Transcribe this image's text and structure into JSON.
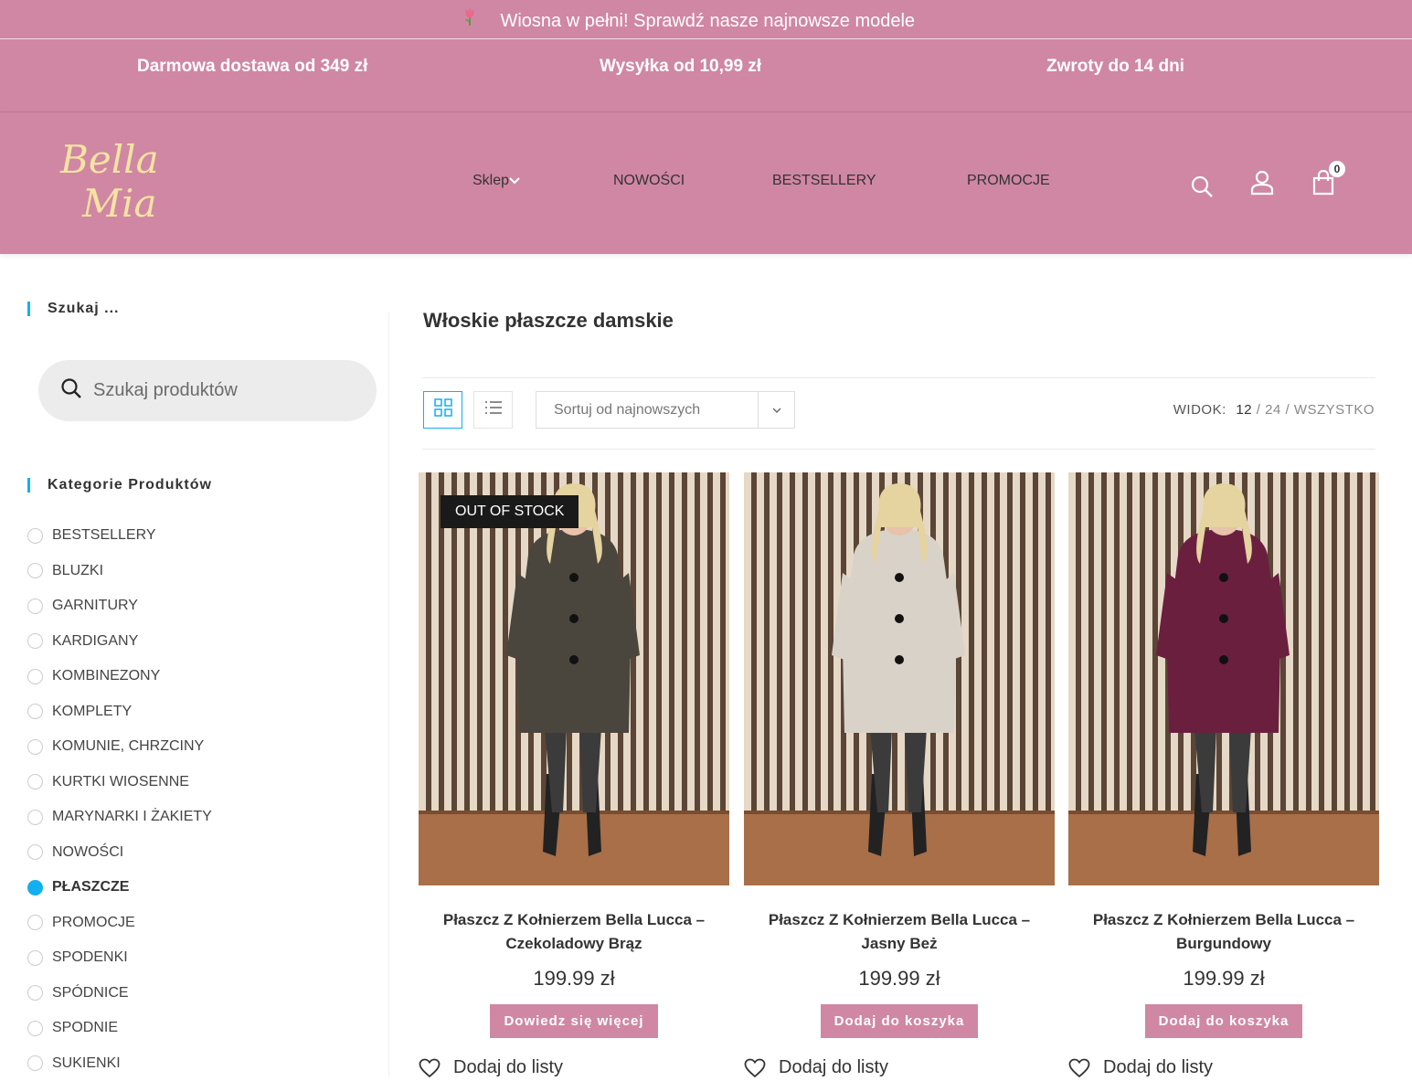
{
  "announcement": "Wiosna w pełni! Sprawdź nasze najnowsze modele",
  "benefits": [
    "Darmowa dostawa od 349 zł",
    "Wysyłka od 10,99 zł",
    "Zwroty do 14 dni"
  ],
  "logo_text": "Bella Mia",
  "nav": [
    {
      "label": "Sklep"
    },
    {
      "label": "NOWOŚCI"
    },
    {
      "label": "BESTSELLERY"
    },
    {
      "label": "PROMOCJE"
    }
  ],
  "cart_count": "0",
  "sidebar": {
    "search_title": "Szukaj ...",
    "search_placeholder": "Szukaj produktów",
    "categories_title": "Kategorie Produktów",
    "categories": [
      "BESTSELLERY",
      "BLUZKI",
      "GARNITURY",
      "KARDIGANY",
      "KOMBINEZONY",
      "KOMPLETY",
      "KOMUNIE, CHRZCINY",
      "KURTKI WIOSENNE",
      "MARYNARKI I ŻAKIETY",
      "NOWOŚCI",
      "PŁASZCZE",
      "PROMOCJE",
      "SPODENKI",
      "SPÓDNICE",
      "SPODNIE",
      "SUKIENKI"
    ],
    "active_category": "PŁASZCZE"
  },
  "main": {
    "title": "Włoskie płaszcze damskie",
    "sort_label": "Sortuj od najnowszych",
    "view_label": "WIDOK:",
    "view_options": [
      "12",
      "24",
      "WSZYSTKO"
    ],
    "view_sep": "/"
  },
  "products": [
    {
      "title": "Płaszcz Z Kołnierzem Bella Lucca – Czekoladowy Brąz",
      "price": "199.99 zł",
      "button": "Dowiedz się więcej",
      "badge": "OUT OF STOCK",
      "wish": "Dodaj do listy",
      "coat_color": "#4b463d"
    },
    {
      "title": "Płaszcz Z Kołnierzem Bella Lucca – Jasny Beż",
      "price": "199.99 zł",
      "button": "Dodaj do koszyka",
      "badge": "",
      "wish": "Dodaj do listy",
      "coat_color": "#d9d2c8"
    },
    {
      "title": "Płaszcz Z Kołnierzem Bella Lucca – Burgundowy",
      "price": "199.99 zł",
      "button": "Dodaj do koszyka",
      "badge": "",
      "wish": "Dodaj do listy",
      "coat_color": "#6b1f3f"
    }
  ],
  "colors": {
    "brand_pink": "#d087a3",
    "accent_blue": "#13aff0",
    "logo_gold": "#f4e3a2"
  }
}
